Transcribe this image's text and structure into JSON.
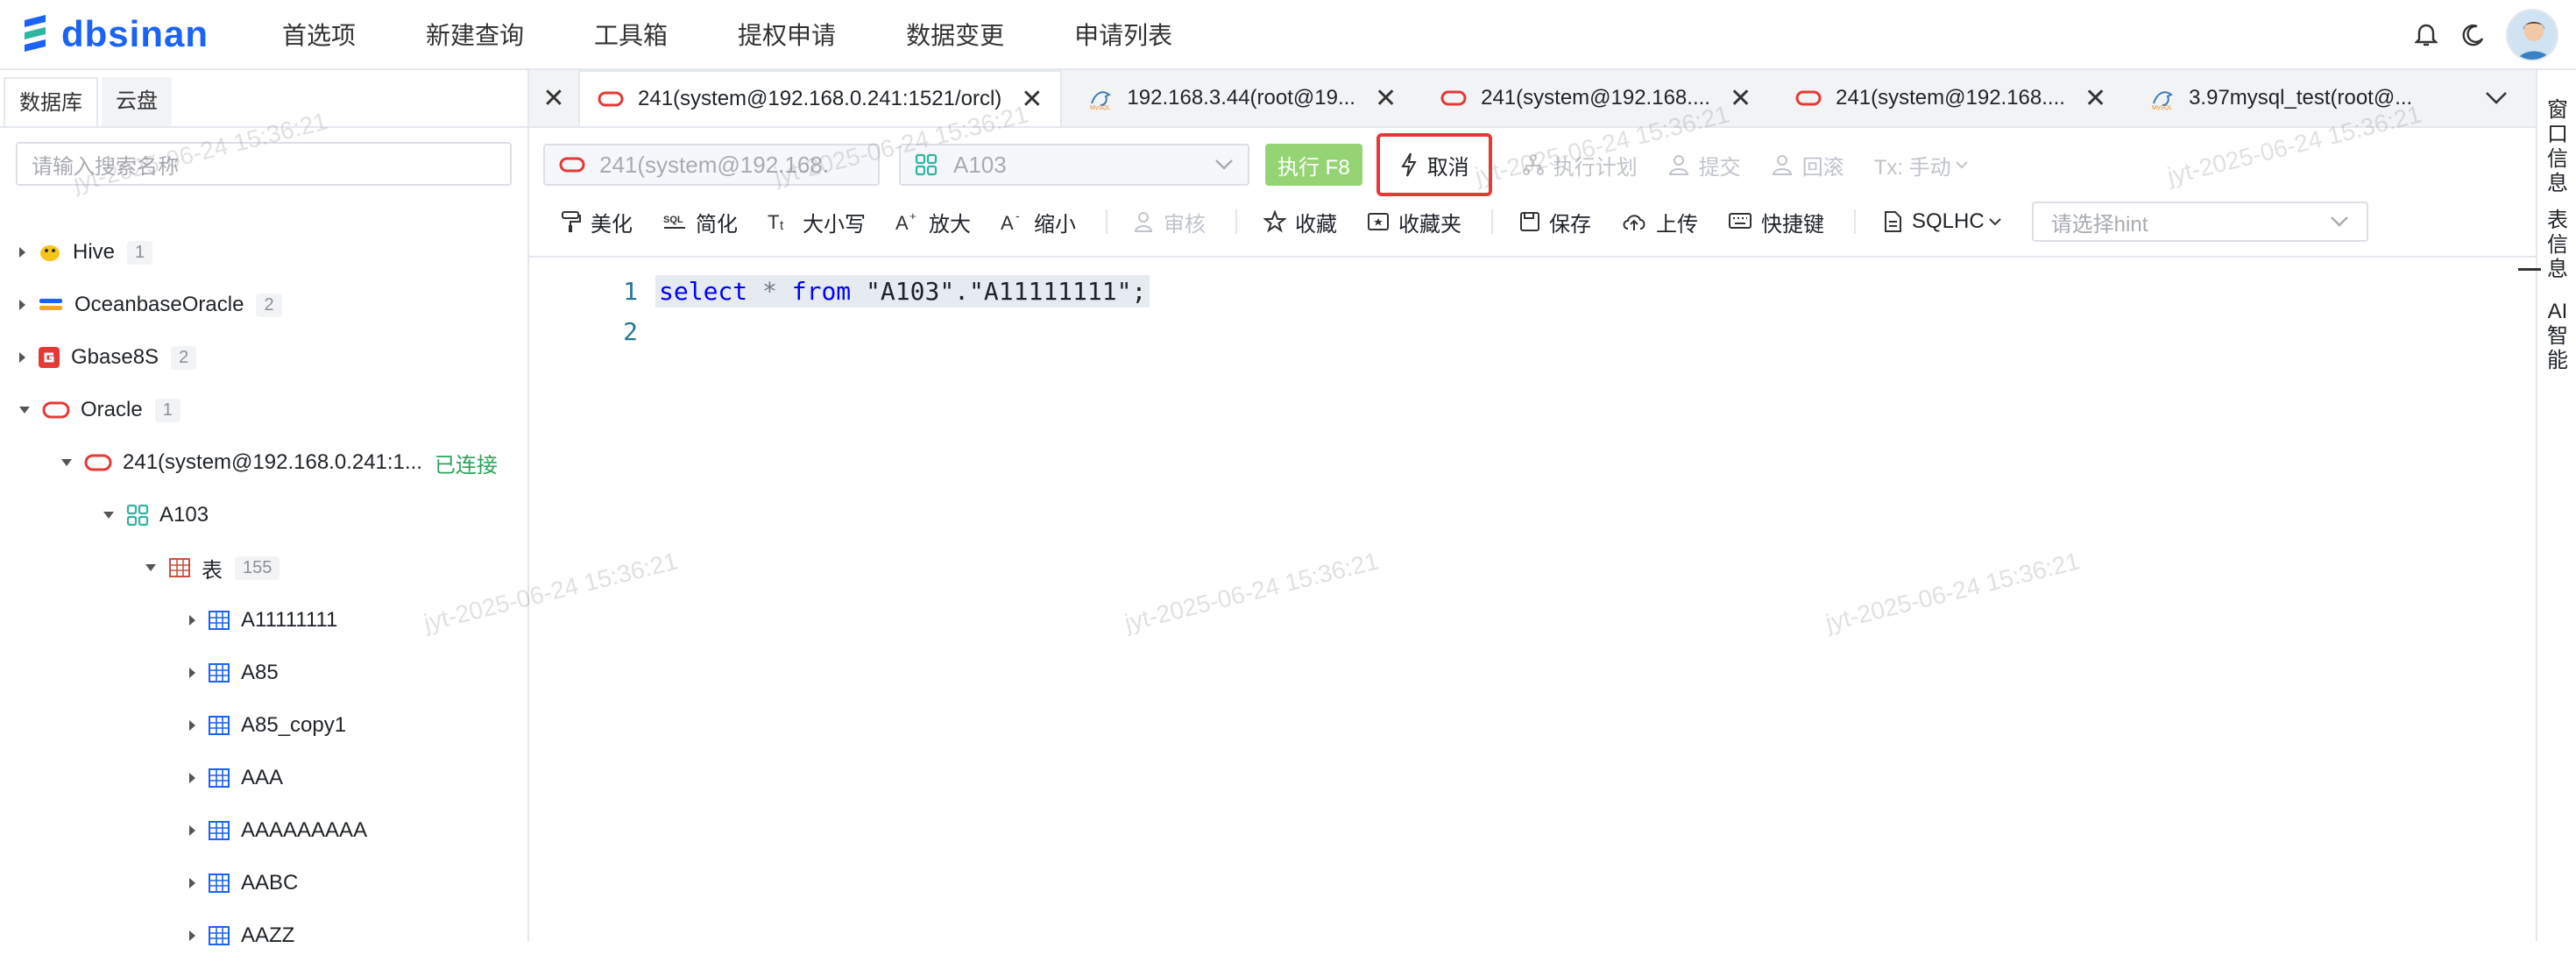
{
  "header": {
    "logo_text": "dbsinan",
    "nav": [
      "首选项",
      "新建查询",
      "工具箱",
      "提权申请",
      "数据变更",
      "申请列表"
    ],
    "icons": [
      "bell-icon",
      "moon-icon",
      "avatar"
    ]
  },
  "sidebar": {
    "tabs": [
      "数据库",
      "云盘"
    ],
    "search_placeholder": "请输入搜索名称",
    "tree": {
      "hive": {
        "label": "Hive",
        "count": "1"
      },
      "oceanbase": {
        "label": "OceanbaseOracle",
        "count": "2"
      },
      "gbase": {
        "label": "Gbase8S",
        "count": "2"
      },
      "oracle": {
        "label": "Oracle",
        "count": "1"
      },
      "conn": {
        "label": "241(system@192.168.0.241:1...",
        "status": "已连接"
      },
      "schema": {
        "label": "A103"
      },
      "tables": {
        "label": "表",
        "count": "155"
      },
      "items": [
        "A11111111",
        "A85",
        "A85_copy1",
        "AAA",
        "AAAAAAAAA",
        "AABC",
        "AAZZ"
      ]
    }
  },
  "tabs": [
    {
      "label": "241(system@192.168.0.241:1521/orcl)",
      "icon": "oracle-icon",
      "active": true
    },
    {
      "label": "192.168.3.44(root@19...",
      "icon": "mysql-icon",
      "active": false
    },
    {
      "label": "241(system@192.168....",
      "icon": "oracle-icon",
      "active": false
    },
    {
      "label": "241(system@192.168....",
      "icon": "oracle-icon",
      "active": false
    },
    {
      "label": "3.97mysql_test(root@...",
      "icon": "mysql-icon",
      "active": false
    }
  ],
  "toolbar": {
    "connection_select": "241(system@192.168.",
    "schema_select": "A103",
    "execute": "执行 F8",
    "cancel": "取消",
    "explain": "执行计划",
    "commit": "提交",
    "rollback": "回滚",
    "tx_mode": "Tx: 手动",
    "beautify": "美化",
    "simplify": "简化",
    "case": "大小写",
    "zoom_in": "放大",
    "zoom_out": "缩小",
    "audit": "审核",
    "favorite": "收藏",
    "favorites": "收藏夹",
    "save": "保存",
    "upload": "上传",
    "shortcuts": "快捷键",
    "dialect": "SQLHC",
    "hint_placeholder": "请选择hint"
  },
  "editor": {
    "line1_num": "1",
    "line2_num": "2",
    "kw_select": "select",
    "star": "*",
    "kw_from": "from",
    "target": "\"A103\".\"A11111111\";"
  },
  "right_rail": [
    "窗口信息",
    "表信息",
    "AI智能"
  ],
  "watermark": "jyt-2025-06-24 15:36:21",
  "colors": {
    "brand": "#1a63f5",
    "execute": "#95d475",
    "highlight_border": "#e53935",
    "connected": "#2fa35a"
  }
}
